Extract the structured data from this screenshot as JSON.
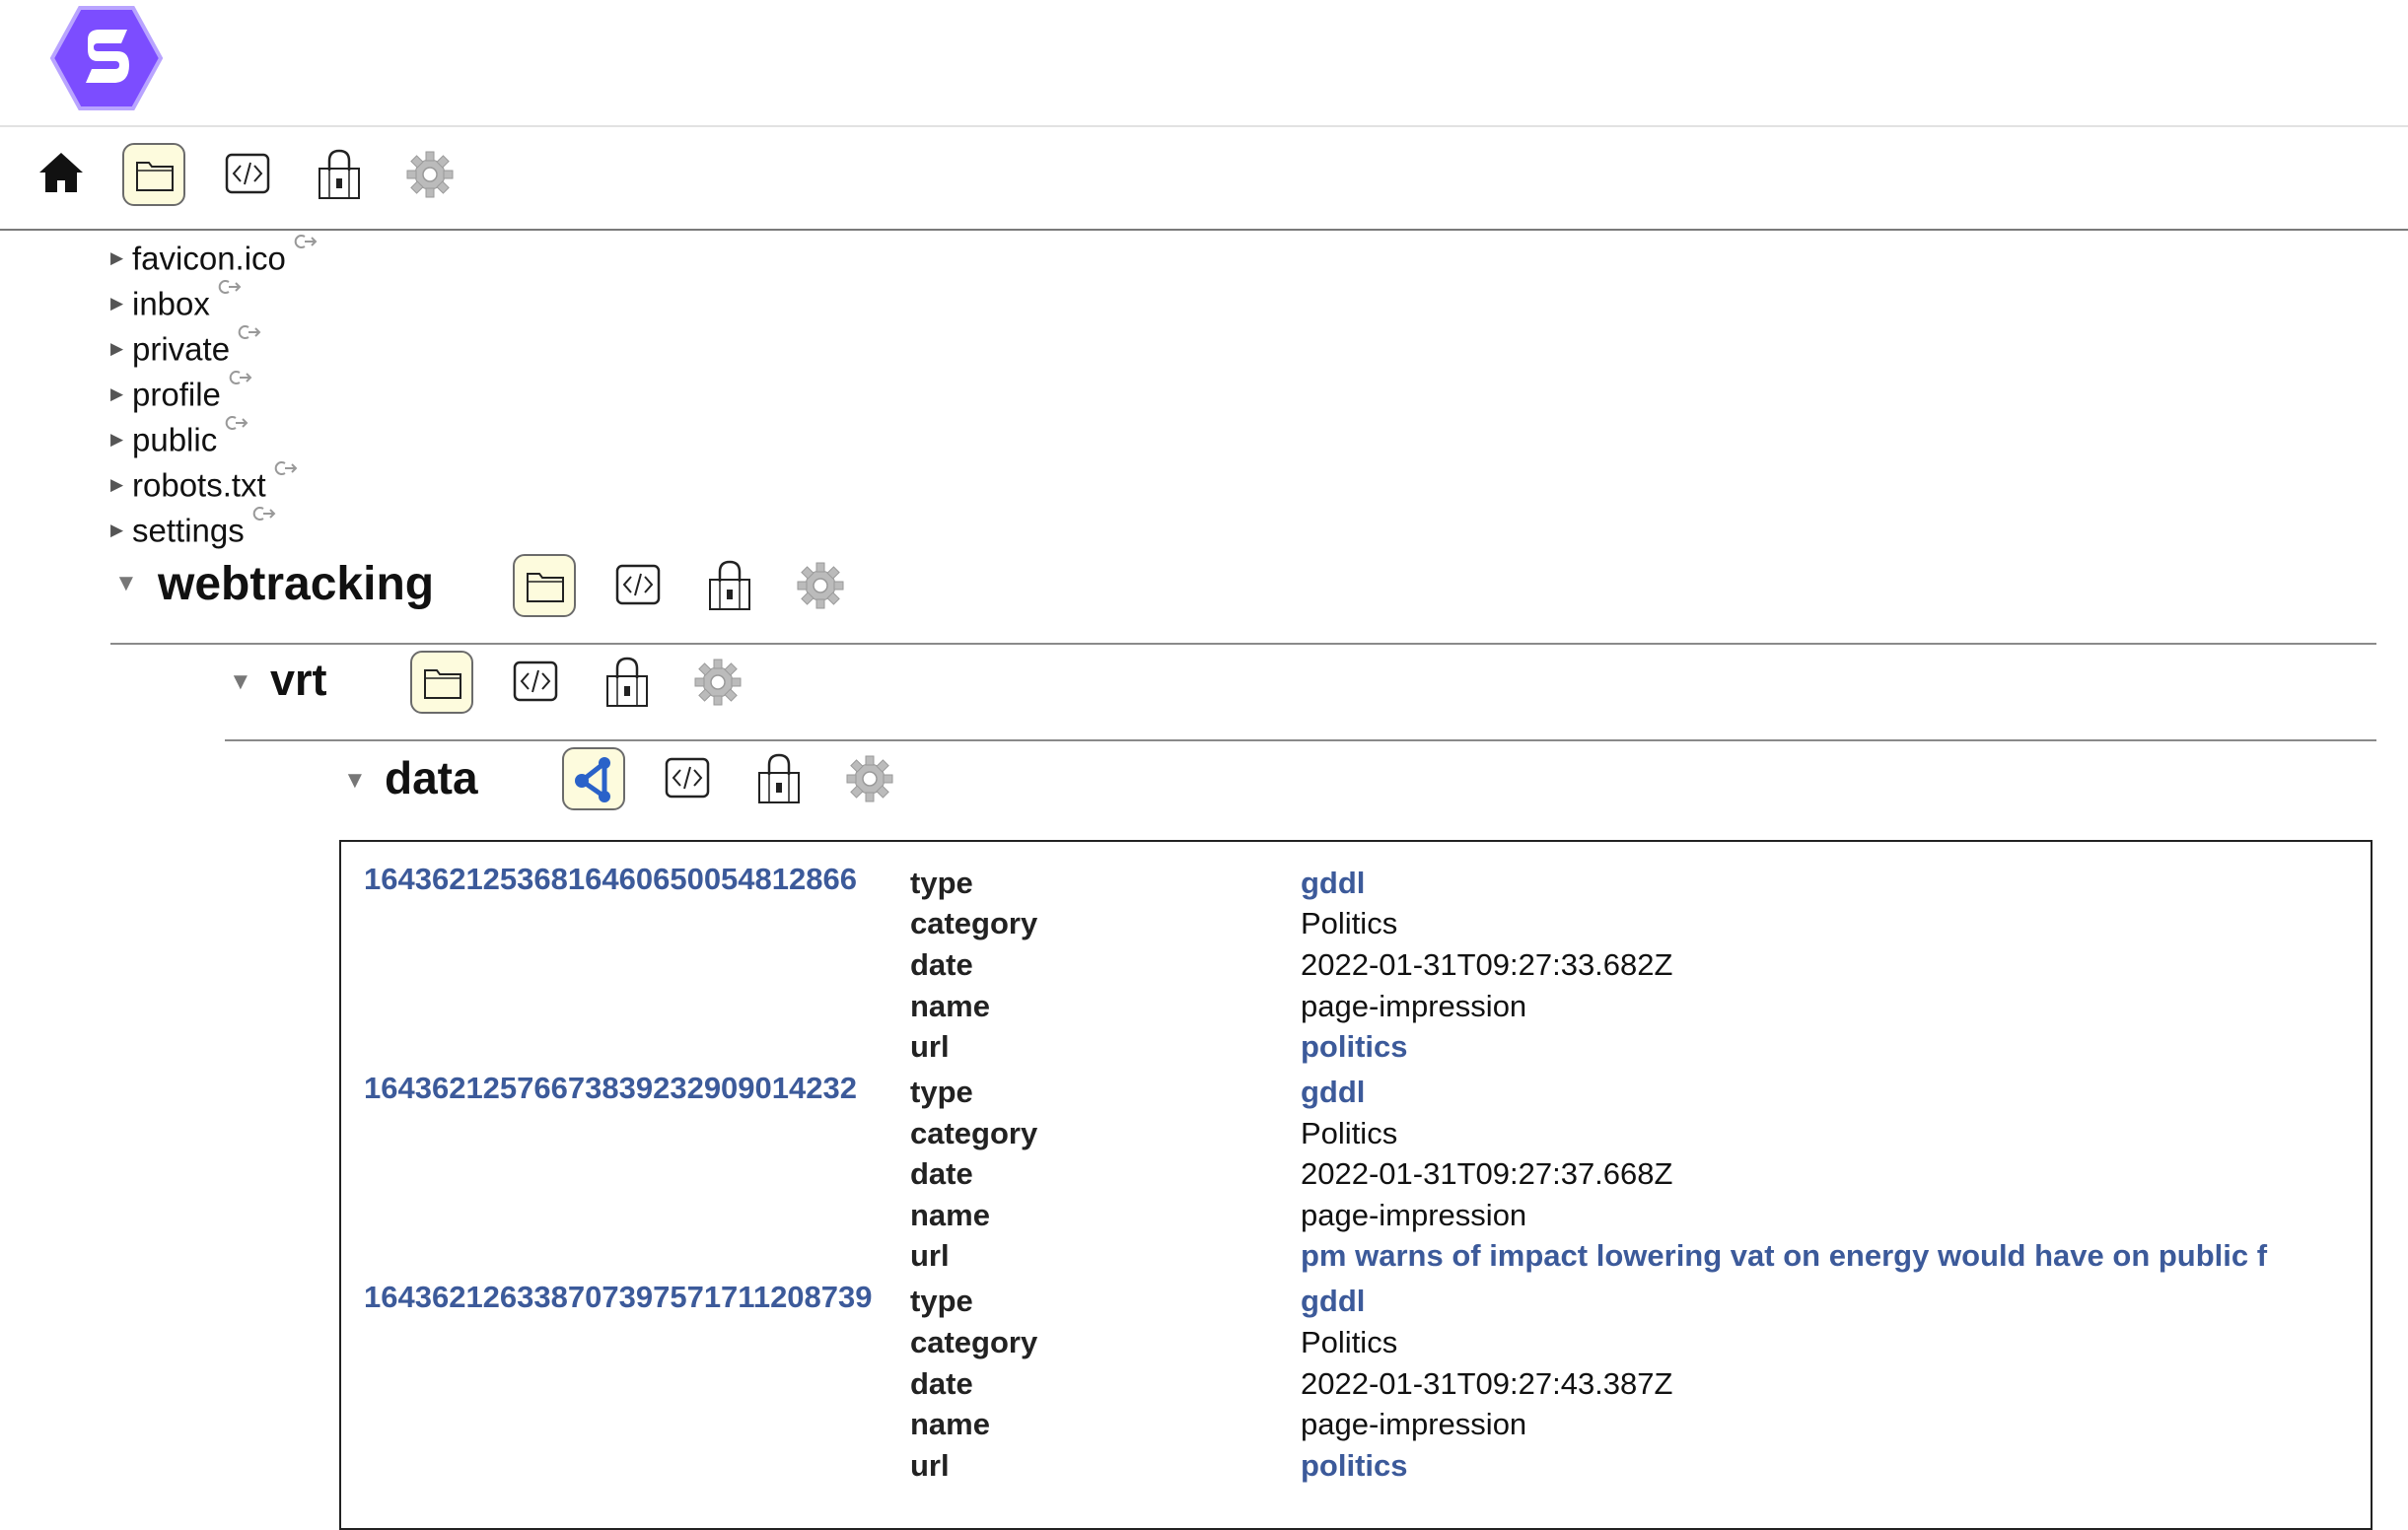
{
  "nav": {
    "home_icon": "home-icon",
    "toolbar_icons": [
      "folder-icon",
      "code-icon",
      "lock-icon",
      "gear-icon"
    ]
  },
  "tree": [
    {
      "label": "favicon.ico"
    },
    {
      "label": "inbox"
    },
    {
      "label": "private"
    },
    {
      "label": "profile"
    },
    {
      "label": "public"
    },
    {
      "label": "robots.txt"
    },
    {
      "label": "settings"
    }
  ],
  "sections": {
    "webtracking": "webtracking",
    "vrt": "vrt",
    "data": "data"
  },
  "records": [
    {
      "id": "164362125368164606500548128​66",
      "fields": [
        {
          "key": "type",
          "value": "gddl",
          "link": true
        },
        {
          "key": "category",
          "value": "Politics",
          "link": false
        },
        {
          "key": "date",
          "value": "2022-01-31T09:27:33.682Z",
          "link": false
        },
        {
          "key": "name",
          "value": "page-impression",
          "link": false
        },
        {
          "key": "url",
          "value": "politics",
          "link": true
        }
      ]
    },
    {
      "id": "16436212576673839232909014232",
      "fields": [
        {
          "key": "type",
          "value": "gddl",
          "link": true
        },
        {
          "key": "category",
          "value": "Politics",
          "link": false
        },
        {
          "key": "date",
          "value": "2022-01-31T09:27:37.668Z",
          "link": false
        },
        {
          "key": "name",
          "value": "page-impression",
          "link": false
        },
        {
          "key": "url",
          "value": "pm warns of impact lowering vat on energy would have on public f",
          "link": true
        }
      ]
    },
    {
      "id": "16436212633870739757171120873​9",
      "fields": [
        {
          "key": "type",
          "value": "gddl",
          "link": true
        },
        {
          "key": "category",
          "value": "Politics",
          "link": false
        },
        {
          "key": "date",
          "value": "2022-01-31T09:27:43.387Z",
          "link": false
        },
        {
          "key": "name",
          "value": "page-impression",
          "link": false
        },
        {
          "key": "url",
          "value": "politics",
          "link": true
        }
      ]
    }
  ]
}
